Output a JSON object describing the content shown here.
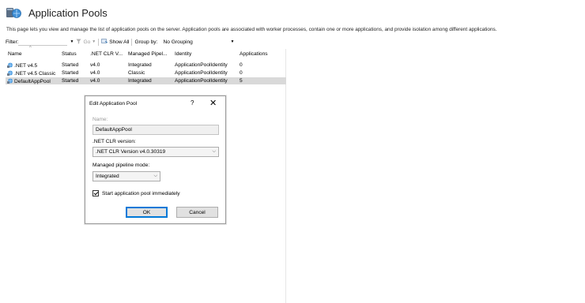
{
  "header": {
    "title": "Application Pools",
    "description": "This page lets you view and manage the list of application pools on the server. Application pools are associated with worker processes, contain one or more applications, and provide isolation among different applications."
  },
  "toolbar": {
    "filter_label": "Filter:",
    "go_label": "Go",
    "show_all_label": "Show All",
    "group_by_label": "Group by:",
    "group_by_value": "No Grouping"
  },
  "grid": {
    "columns": [
      "Name",
      "Status",
      ".NET CLR V...",
      "Managed Pipel...",
      "Identity",
      "Applications"
    ],
    "rows": [
      {
        "name": ".NET v4.5",
        "status": "Started",
        "clr": "v4.0",
        "pipeline": "Integrated",
        "identity": "ApplicationPoolIdentity",
        "apps": "0"
      },
      {
        "name": ".NET v4.5 Classic",
        "status": "Started",
        "clr": "v4.0",
        "pipeline": "Classic",
        "identity": "ApplicationPoolIdentity",
        "apps": "0"
      },
      {
        "name": "DefaultAppPool",
        "status": "Started",
        "clr": "v4.0",
        "pipeline": "Integrated",
        "identity": "ApplicationPoolIdentity",
        "apps": "5"
      }
    ]
  },
  "dialog": {
    "title": "Edit Application Pool",
    "help": "?",
    "close": "✕",
    "name_label": "Name:",
    "name_value": "DefaultAppPool",
    "clr_label": ".NET CLR version:",
    "clr_value": ".NET CLR Version v4.0.30319",
    "pipeline_label": "Managed pipeline mode:",
    "pipeline_value": "Integrated",
    "start_label": "Start application pool immediately",
    "ok_label": "OK",
    "cancel_label": "Cancel"
  }
}
